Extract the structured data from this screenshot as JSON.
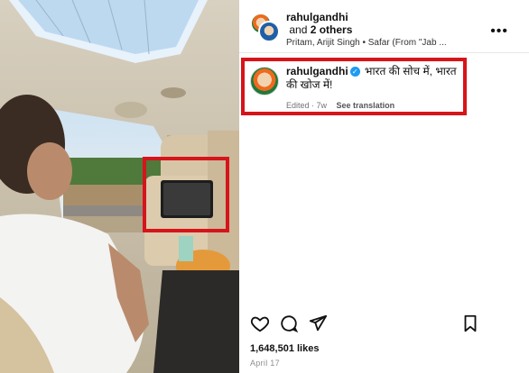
{
  "post": {
    "author": "rahulgandhi",
    "collaborators": "and 2 others",
    "collaborators_prefix": "and ",
    "collaborators_count": "2 others",
    "music": "Pritam, Arijit Singh • Safar (From \"Jab ...",
    "more_icon": "more-horizontal-icon"
  },
  "caption": {
    "username": "rahulgandhi",
    "text": "भारत की सोच में, भारत की खोज में!",
    "edited": "Edited · 7w",
    "translation_link": "See translation"
  },
  "engagement": {
    "likes": "1,648,501 likes",
    "date": "April 17"
  },
  "icons": [
    "heart-icon",
    "comment-icon",
    "share-icon",
    "bookmark-icon"
  ],
  "colors": {
    "highlight": "#d6141a",
    "verified": "#1d9bf0"
  }
}
